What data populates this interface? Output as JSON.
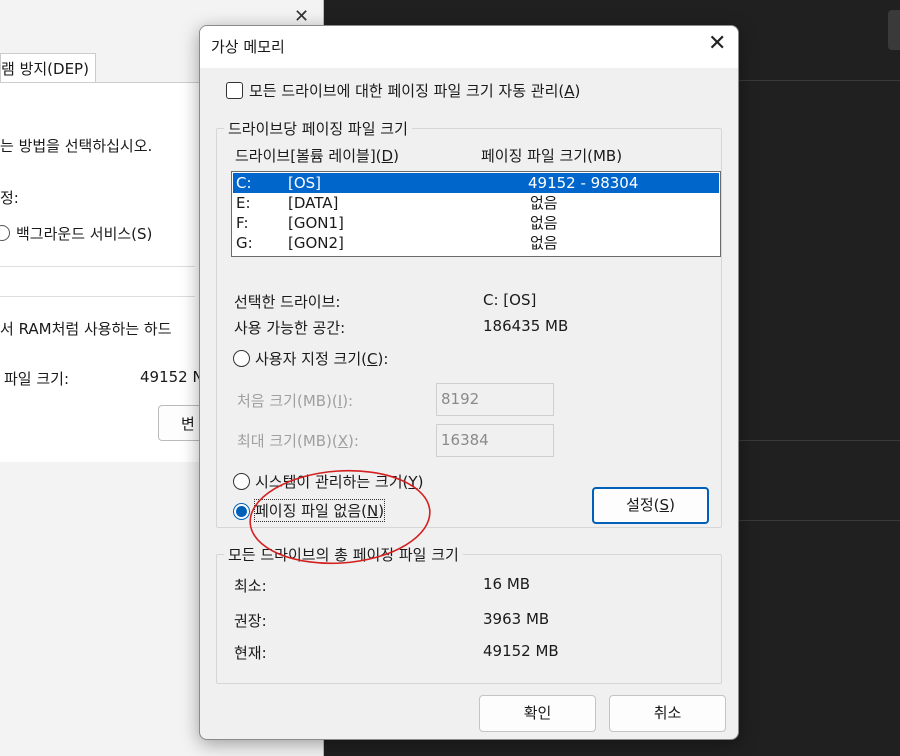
{
  "background_window": {
    "tab_label": "램 방지(DEP)",
    "line_method": "는 방법을 선택하십시오.",
    "line_jung": "정:",
    "radio_background": "백그라운드 서비스(S)",
    "line_ram": "서 RAM처럼 사용하는 하드",
    "paging_label": "파일 크기:",
    "paging_value": "49152 N",
    "change_button": "변"
  },
  "dialog": {
    "title": "가상 메모리",
    "auto_manage_label": "모든 드라이브에 대한 페이징 파일 크기 자동 관리(",
    "auto_manage_key": "A",
    "auto_manage_suffix": ")",
    "per_drive_group": "드라이브당 페이징 파일 크기",
    "col_drive": "드라이브[볼륨 레이블](",
    "col_drive_key": "D",
    "col_drive_suffix": ")",
    "col_size": "페이징 파일 크기(MB)",
    "drives": [
      {
        "letter": "C:",
        "label": "[OS]",
        "size": "49152 - 98304"
      },
      {
        "letter": "E:",
        "label": "[DATA]",
        "size": "없음"
      },
      {
        "letter": "F:",
        "label": "[GON1]",
        "size": "없음"
      },
      {
        "letter": "G:",
        "label": "[GON2]",
        "size": "없음"
      }
    ],
    "selected_drive_label": "선택한 드라이브:",
    "selected_drive_value": "C:  [OS]",
    "free_space_label": "사용 가능한 공간:",
    "free_space_value": "186435 MB",
    "custom_size_label": "사용자 지정 크기(",
    "custom_size_key": "C",
    "custom_size_suffix": "):",
    "initial_size_label": "처음 크기(MB)(",
    "initial_size_key": "I",
    "initial_size_suffix": "):",
    "initial_size_value": "8192",
    "max_size_label": "최대 크기(MB)(",
    "max_size_key": "X",
    "max_size_suffix": "):",
    "max_size_value": "16384",
    "system_managed_label": "시스템이 관리하는 크기(",
    "system_managed_key": "Y",
    "system_managed_suffix": ")",
    "no_paging_label": "페이징 파일 없음(",
    "no_paging_key": "N",
    "no_paging_suffix": ")",
    "set_button": "설정(",
    "set_button_key": "S",
    "set_button_suffix": ")",
    "total_group": "모든 드라이브의 총 페이징 파일 크기",
    "min_label": "최소:",
    "min_value": "16 MB",
    "recommended_label": "권장:",
    "recommended_value": "3963 MB",
    "current_label": "현재:",
    "current_value": "49152 MB",
    "ok_button": "확인",
    "cancel_button": "취소"
  },
  "colors": {
    "accent": "#005fb8",
    "selection": "#0066cc",
    "annotation": "#d42020"
  }
}
